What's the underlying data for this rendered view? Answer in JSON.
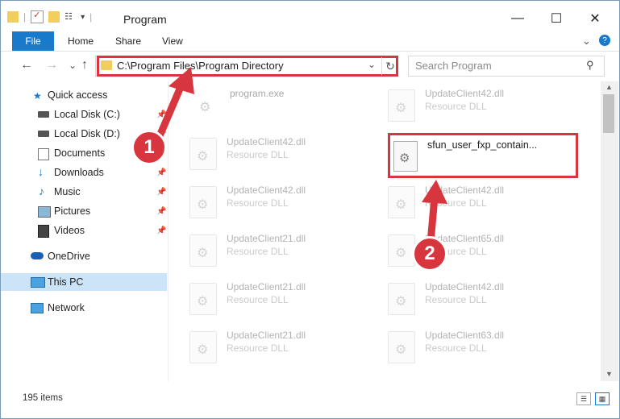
{
  "window": {
    "title": "Program",
    "controls": {
      "minimize": "—",
      "maximize": "☐",
      "close": "✕"
    }
  },
  "ribbon": {
    "tabs": [
      "File",
      "Home",
      "Share",
      "View"
    ],
    "expand": "⌄",
    "help": "?"
  },
  "address": {
    "path": "C:\\Program Files\\Program Directory",
    "dropdown": "⌄",
    "refresh": "↻"
  },
  "search": {
    "placeholder": "Search Program",
    "icon": "search-icon"
  },
  "nav": {
    "back": "←",
    "forward": "→",
    "recent": "⌄",
    "up": "↑",
    "items": [
      {
        "label": "Quick access",
        "icon": "star-icon"
      },
      {
        "label": "Local Disk (C:)",
        "icon": "drive-icon"
      },
      {
        "label": "Local Disk (D:)",
        "icon": "drive-icon"
      },
      {
        "label": "Documents",
        "icon": "documents-icon"
      },
      {
        "label": "Downloads",
        "icon": "download-icon"
      },
      {
        "label": "Music",
        "icon": "music-icon"
      },
      {
        "label": "Pictures",
        "icon": "pictures-icon"
      },
      {
        "label": "Videos",
        "icon": "videos-icon"
      },
      {
        "label": "OneDrive",
        "icon": "cloud-icon"
      },
      {
        "label": "This PC",
        "icon": "pc-icon"
      },
      {
        "label": "Network",
        "icon": "network-icon"
      }
    ]
  },
  "files": [
    {
      "name": "program.exe",
      "type": ""
    },
    {
      "name": "UpdateClient42.dll",
      "type": "Resource DLL"
    },
    {
      "name": "UpdateClient42.dll",
      "type": "Resource DLL"
    },
    {
      "name": "sfun_user_fxp_contain...",
      "type": ""
    },
    {
      "name": "UpdateClient42.dll",
      "type": "Resource DLL"
    },
    {
      "name": "UpdateClient42.dll",
      "type": "Resource DLL"
    },
    {
      "name": "UpdateClient21.dll",
      "type": "Resource DLL"
    },
    {
      "name": "UpdateClient65.dll",
      "type": "Resource DLL"
    },
    {
      "name": "UpdateClient21.dll",
      "type": "Resource DLL"
    },
    {
      "name": "UpdateClient42.dll",
      "type": "Resource DLL"
    },
    {
      "name": "UpdateClient21.dll",
      "type": "Resource DLL"
    },
    {
      "name": "UpdateClient63.dll",
      "type": "Resource DLL"
    }
  ],
  "status": {
    "count": "195 items"
  },
  "annotations": {
    "one": "1",
    "two": "2",
    "color": "#d8363f"
  }
}
